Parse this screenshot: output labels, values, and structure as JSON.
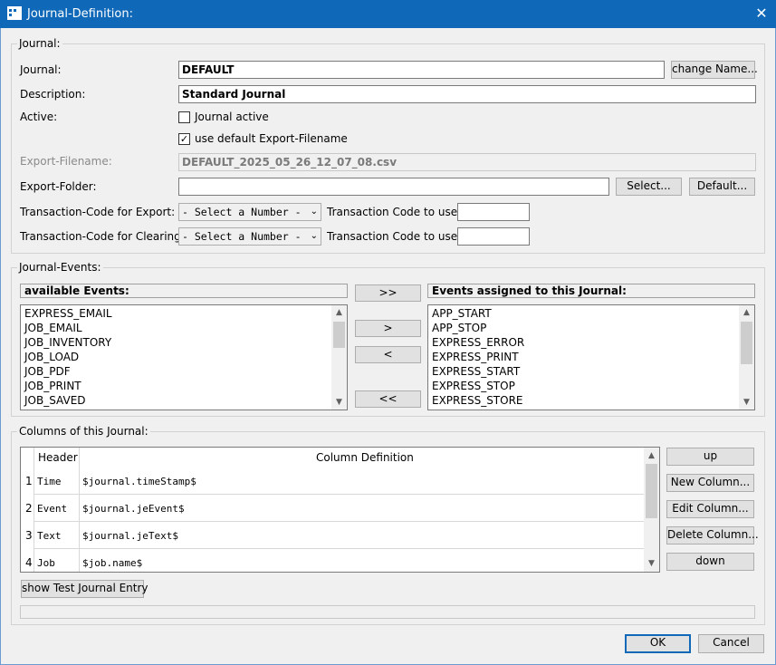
{
  "window": {
    "title": "Journal-Definition:",
    "close_glyph": "✕",
    "icon": "app-icon"
  },
  "journal_group": {
    "label": "Journal:",
    "journal_label": "Journal:",
    "journal_value": "DEFAULT",
    "change_name_button": "change Name...",
    "description_label": "Description:",
    "description_value": "Standard Journal",
    "active_label": "Active:",
    "journal_active_label": "Journal active",
    "journal_active_checked": false,
    "use_default_export_label": "use default Export-Filename",
    "use_default_export_checked": true,
    "check_glyph": "✓",
    "export_filename_label": "Export-Filename:",
    "export_filename_value": "DEFAULT_2025_05_26_12_07_08.csv",
    "export_folder_label": "Export-Folder:",
    "export_folder_value": "",
    "select_button": "Select...",
    "default_button": "Default...",
    "tc_export_label": "Transaction-Code for Export:",
    "tc_export_select": "- Select a Number -",
    "tc_export_use_label": "Transaction Code to use:",
    "tc_export_use_value": "",
    "tc_clearing_label": "Transaction-Code for Clearing:",
    "tc_clearing_select": "- Select a Number -",
    "tc_clearing_use_label": "Transaction Code to use:",
    "tc_clearing_use_value": "",
    "dropdown_glyph": "⌄"
  },
  "events_group": {
    "label": "Journal-Events:",
    "available_header": "available Events:",
    "available": [
      "EXPRESS_EMAIL",
      "JOB_EMAIL",
      "JOB_INVENTORY",
      "JOB_LOAD",
      "JOB_PDF",
      "JOB_PRINT",
      "JOB_SAVED"
    ],
    "assigned_header": "Events assigned to this Journal:",
    "assigned": [
      "APP_START",
      "APP_STOP",
      "EXPRESS_ERROR",
      "EXPRESS_PRINT",
      "EXPRESS_START",
      "EXPRESS_STOP",
      "EXPRESS_STORE"
    ],
    "add_all_button": ">>",
    "add_button": ">",
    "remove_button": "<",
    "remove_all_button": "<<",
    "scroll_up_glyph": "▲",
    "scroll_down_glyph": "▼"
  },
  "columns_group": {
    "label": "Columns of this Journal:",
    "header_col": "Header",
    "definition_col": "Column Definition",
    "rows": [
      {
        "num": "1",
        "header": "Time",
        "definition": "$journal.timeStamp$"
      },
      {
        "num": "2",
        "header": "Event",
        "definition": "$journal.jeEvent$"
      },
      {
        "num": "3",
        "header": "Text",
        "definition": "$journal.jeText$"
      },
      {
        "num": "4",
        "header": "Job",
        "definition": "$job.name$"
      }
    ],
    "up_button": "up",
    "new_column_button": "New Column...",
    "edit_column_button": "Edit Column...",
    "delete_column_button": "Delete Column...",
    "down_button": "down",
    "show_test_button": "show Test Journal Entry",
    "status_text": ""
  },
  "footer": {
    "ok_button": "OK",
    "cancel_button": "Cancel"
  }
}
